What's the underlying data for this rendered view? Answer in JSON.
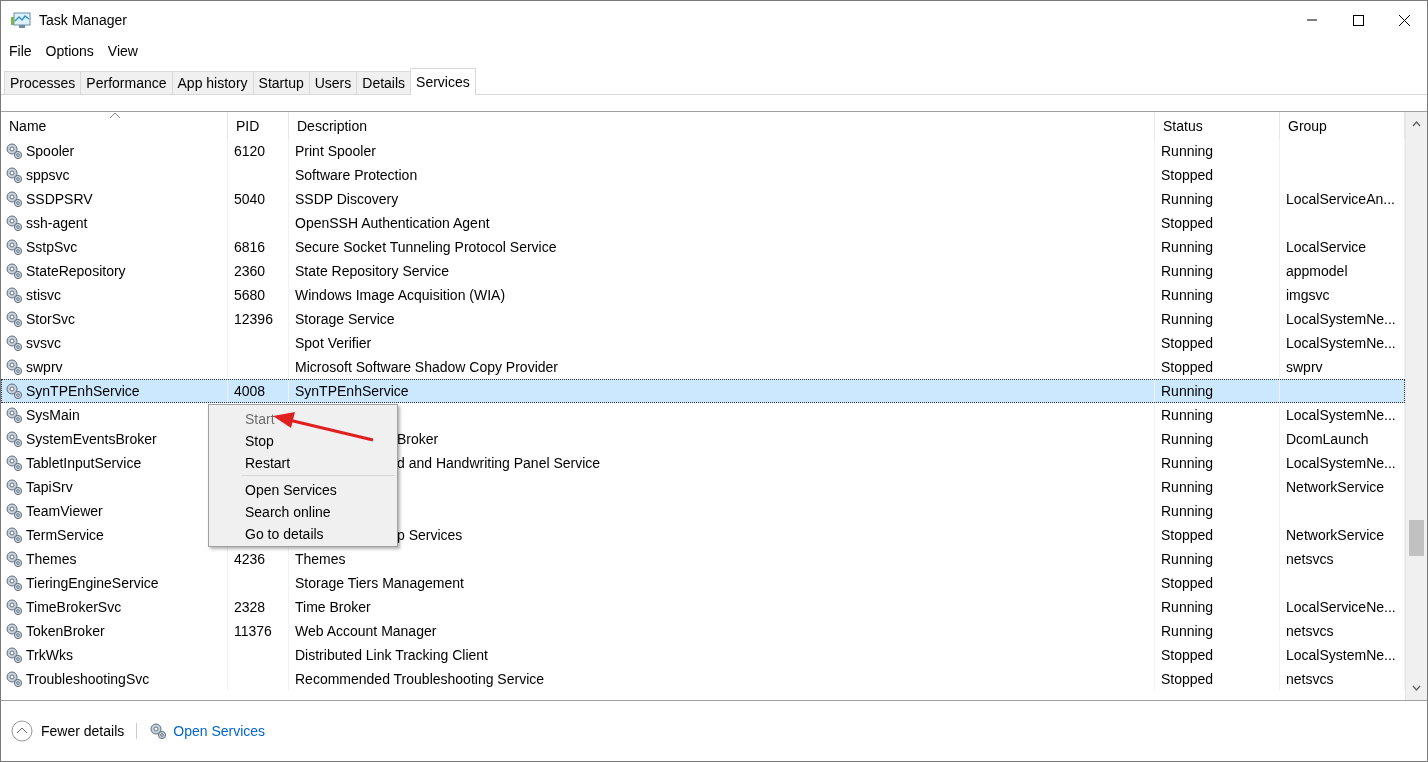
{
  "window": {
    "title": "Task Manager"
  },
  "menu_bar": [
    "File",
    "Options",
    "View"
  ],
  "tabs": [
    {
      "label": "Processes",
      "selected": false
    },
    {
      "label": "Performance",
      "selected": false
    },
    {
      "label": "App history",
      "selected": false
    },
    {
      "label": "Startup",
      "selected": false
    },
    {
      "label": "Users",
      "selected": false
    },
    {
      "label": "Details",
      "selected": false
    },
    {
      "label": "Services",
      "selected": true
    }
  ],
  "table": {
    "columns": [
      "Name",
      "PID",
      "Description",
      "Status",
      "Group"
    ],
    "rows": [
      {
        "name": "Spooler",
        "pid": "6120",
        "description": "Print Spooler",
        "status": "Running",
        "group": "",
        "selected": false
      },
      {
        "name": "sppsvc",
        "pid": "",
        "description": "Software Protection",
        "status": "Stopped",
        "group": "",
        "selected": false
      },
      {
        "name": "SSDPSRV",
        "pid": "5040",
        "description": "SSDP Discovery",
        "status": "Running",
        "group": "LocalServiceAn...",
        "selected": false
      },
      {
        "name": "ssh-agent",
        "pid": "",
        "description": "OpenSSH Authentication Agent",
        "status": "Stopped",
        "group": "",
        "selected": false
      },
      {
        "name": "SstpSvc",
        "pid": "6816",
        "description": "Secure Socket Tunneling Protocol Service",
        "status": "Running",
        "group": "LocalService",
        "selected": false
      },
      {
        "name": "StateRepository",
        "pid": "2360",
        "description": "State Repository Service",
        "status": "Running",
        "group": "appmodel",
        "selected": false
      },
      {
        "name": "stisvc",
        "pid": "5680",
        "description": "Windows Image Acquisition (WIA)",
        "status": "Running",
        "group": "imgsvc",
        "selected": false
      },
      {
        "name": "StorSvc",
        "pid": "12396",
        "description": "Storage Service",
        "status": "Running",
        "group": "LocalSystemNe...",
        "selected": false
      },
      {
        "name": "svsvc",
        "pid": "",
        "description": "Spot Verifier",
        "status": "Stopped",
        "group": "LocalSystemNe...",
        "selected": false
      },
      {
        "name": "swprv",
        "pid": "",
        "description": "Microsoft Software Shadow Copy Provider",
        "status": "Stopped",
        "group": "swprv",
        "selected": false
      },
      {
        "name": "SynTPEnhService",
        "pid": "4008",
        "description": "SynTPEnhService",
        "status": "Running",
        "group": "",
        "selected": true
      },
      {
        "name": "SysMain",
        "pid": "",
        "description": "",
        "status": "Running",
        "group": "LocalSystemNe...",
        "selected": false
      },
      {
        "name": "SystemEventsBroker",
        "pid": "",
        "description": "Broker",
        "status": "Running",
        "group": "DcomLaunch",
        "selected": false,
        "covered": true
      },
      {
        "name": "TabletInputService",
        "pid": "",
        "description": "d and Handwriting Panel Service",
        "status": "Running",
        "group": "LocalSystemNe...",
        "selected": false,
        "covered": true
      },
      {
        "name": "TapiSrv",
        "pid": "",
        "description": "",
        "status": "Running",
        "group": "NetworkService",
        "selected": false
      },
      {
        "name": "TeamViewer",
        "pid": "",
        "description": "",
        "status": "Running",
        "group": "",
        "selected": false
      },
      {
        "name": "TermService",
        "pid": "",
        "description": "p Services",
        "status": "Stopped",
        "group": "NetworkService",
        "selected": false,
        "covered": true
      },
      {
        "name": "Themes",
        "pid": "4236",
        "description": "Themes",
        "status": "Running",
        "group": "netsvcs",
        "selected": false
      },
      {
        "name": "TieringEngineService",
        "pid": "",
        "description": "Storage Tiers Management",
        "status": "Stopped",
        "group": "",
        "selected": false
      },
      {
        "name": "TimeBrokerSvc",
        "pid": "2328",
        "description": "Time Broker",
        "status": "Running",
        "group": "LocalServiceNe...",
        "selected": false
      },
      {
        "name": "TokenBroker",
        "pid": "11376",
        "description": "Web Account Manager",
        "status": "Running",
        "group": "netsvcs",
        "selected": false
      },
      {
        "name": "TrkWks",
        "pid": "",
        "description": "Distributed Link Tracking Client",
        "status": "Stopped",
        "group": "LocalSystemNe...",
        "selected": false
      },
      {
        "name": "TroubleshootingSvc",
        "pid": "",
        "description": "Recommended Troubleshooting Service",
        "status": "Stopped",
        "group": "netsvcs",
        "selected": false
      }
    ]
  },
  "context_menu": [
    {
      "label": "Start",
      "disabled": true
    },
    {
      "label": "Stop",
      "disabled": false
    },
    {
      "label": "Restart",
      "disabled": false
    },
    {
      "kind": "separator"
    },
    {
      "label": "Open Services",
      "disabled": false
    },
    {
      "label": "Search online",
      "disabled": false
    },
    {
      "label": "Go to details",
      "disabled": false
    }
  ],
  "footer": {
    "fewer_details": "Fewer details",
    "open_services": "Open Services"
  }
}
